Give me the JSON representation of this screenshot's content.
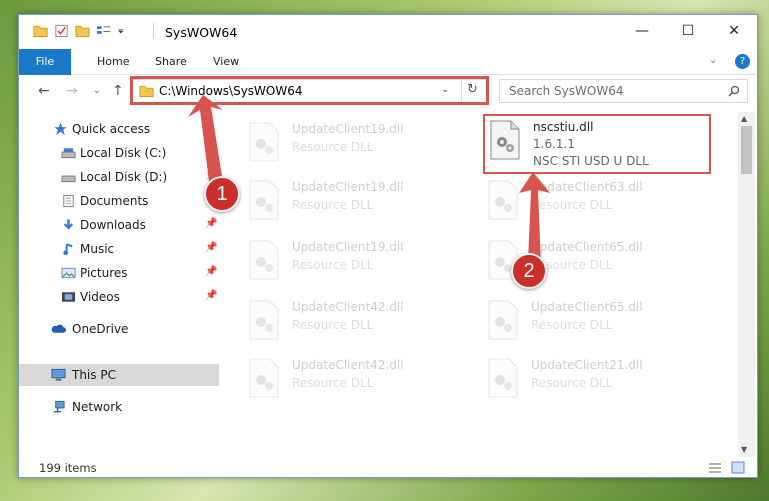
{
  "window": {
    "title": "SysWOW64",
    "minimize_glyph": "—",
    "maximize_glyph": "☐",
    "close_glyph": "✕"
  },
  "ribbon": {
    "tabs": [
      {
        "label": "File"
      },
      {
        "label": "Home"
      },
      {
        "label": "Share"
      },
      {
        "label": "View"
      }
    ],
    "help_glyph": "?"
  },
  "navigation": {
    "address_path": "C:\\Windows\\SysWOW64",
    "search_placeholder": "Search SysWOW64"
  },
  "sidebar": {
    "items": [
      {
        "label": "Quick access",
        "icon": "star-icon"
      },
      {
        "label": "Local Disk (C:)",
        "icon": "drive-icon"
      },
      {
        "label": "Local Disk (D:)",
        "icon": "drive-icon"
      },
      {
        "label": "Documents",
        "icon": "documents-icon"
      },
      {
        "label": "Downloads",
        "icon": "downloads-icon"
      },
      {
        "label": "Music",
        "icon": "music-icon"
      },
      {
        "label": "Pictures",
        "icon": "pictures-icon"
      },
      {
        "label": "Videos",
        "icon": "videos-icon"
      },
      {
        "label": "OneDrive",
        "icon": "cloud-icon"
      },
      {
        "label": "This PC",
        "icon": "computer-icon"
      },
      {
        "label": "Network",
        "icon": "network-icon"
      }
    ]
  },
  "files": [
    {
      "name": "UpdateClient19.dll",
      "meta": "Resource DLL"
    },
    {
      "name": "nscstiu.dll",
      "version": "1.6.1.1",
      "description": "NSC STI USD U DLL"
    },
    {
      "name": "UpdateClient19.dll",
      "meta": "Resource DLL"
    },
    {
      "name": "UpdateClient63.dll",
      "meta": "Resource DLL"
    },
    {
      "name": "UpdateClient19.dll",
      "meta": "Resource DLL"
    },
    {
      "name": "UpdateClient65.dll",
      "meta": "Resource DLL"
    },
    {
      "name": "UpdateClient42.dll",
      "meta": "Resource DLL"
    },
    {
      "name": "UpdateClient65.dll",
      "meta": "Resource DLL"
    },
    {
      "name": "UpdateClient42.dll",
      "meta": "Resource DLL"
    },
    {
      "name": "UpdateClient21.dll",
      "meta": "Resource DLL"
    }
  ],
  "status": {
    "item_count": "199 items"
  },
  "annotations": {
    "badge1": "1",
    "badge2": "2",
    "color": "#d9534f"
  }
}
